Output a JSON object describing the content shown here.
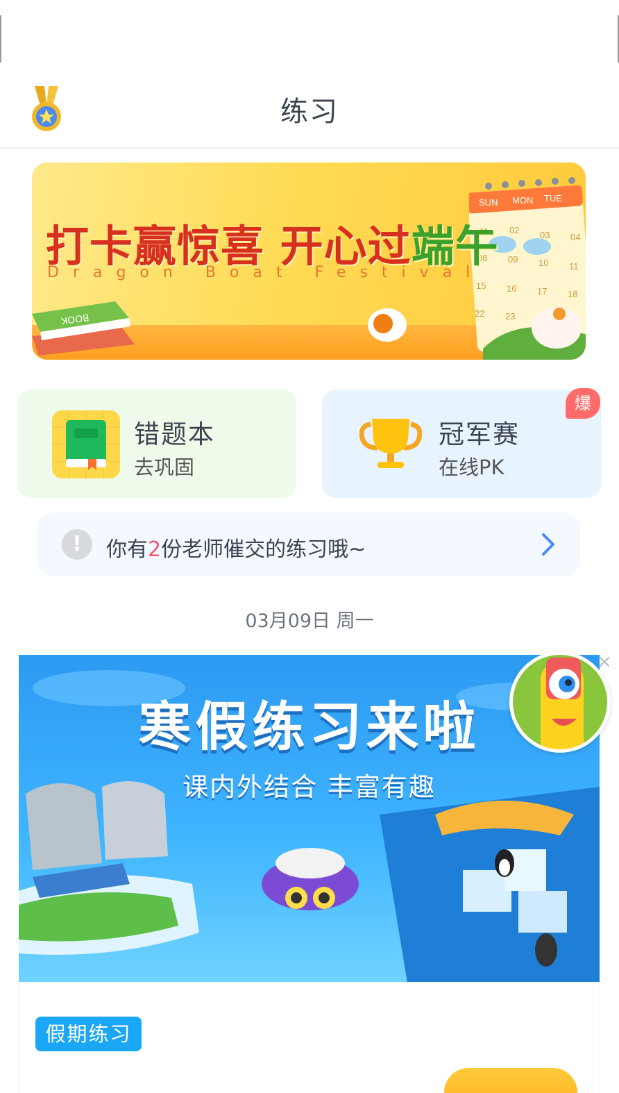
{
  "header": {
    "title": "练习",
    "medal_icon": "medal-icon"
  },
  "banner": {
    "headline_part1": "打卡赢惊喜 开心过",
    "headline_part2": "端午",
    "subtitle": "Dragon Boat Festival",
    "book_label": "BOOK",
    "calendar_days": [
      "SUN",
      "MON",
      "TUE"
    ],
    "calendar_dates": [
      "01",
      "02",
      "03",
      "04",
      "08",
      "09",
      "10",
      "11",
      "15",
      "16",
      "17",
      "18",
      "22",
      "23"
    ]
  },
  "cards": {
    "wrong_book": {
      "title": "错题本",
      "subtitle": "去巩固",
      "icon": "green-book-icon"
    },
    "championship": {
      "title": "冠军赛",
      "subtitle": "在线PK",
      "icon": "trophy-icon",
      "badge": "爆"
    }
  },
  "notice": {
    "prefix": "你有",
    "count": "2",
    "suffix": "份老师催交的练习哦~",
    "icon": "alert-icon"
  },
  "date_label": "03月09日 周一",
  "hero": {
    "title": "寒假练习来啦",
    "subtitle": "课内外结合 丰富有趣"
  },
  "practice_tag": "假期练习",
  "colors": {
    "accent_blue": "#1aa7f5",
    "badge_red": "#ff6b6b",
    "notice_number": "#f4566b"
  }
}
